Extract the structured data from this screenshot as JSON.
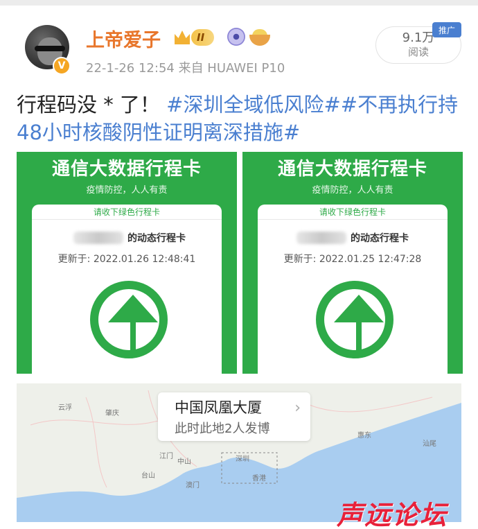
{
  "user": {
    "name": "上帝爱子",
    "level": "II",
    "verified_badge": "V",
    "meta": "22-1-26 12:54  来自 HUAWEI P10"
  },
  "read_count": {
    "value": "9.1万",
    "label": "阅读",
    "ad_tag": "推广"
  },
  "post": {
    "text_plain": "行程码没 * 了！",
    "tag1": "#深圳全域低风险#",
    "tag2": "#不再执行持48小时核酸阴性证明离深措施#"
  },
  "cards": [
    {
      "title": "通信大数据行程卡",
      "subtitle": "疫情防控，人人有责",
      "notice": "请收下绿色行程卡",
      "dynamic_label": "的动态行程卡",
      "updated": "更新于: 2022.01.26 12:48:41",
      "color": "#2eaa48"
    },
    {
      "title": "通信大数据行程卡",
      "subtitle": "疫情防控，人人有责",
      "notice": "请收下绿色行程卡",
      "dynamic_label": "的动态行程卡",
      "updated": "更新于: 2022.01.25 12:47:28",
      "color": "#2eaa48"
    }
  ],
  "location": {
    "name": "中国凤凰大厦",
    "sub": "此时此地2人发博"
  },
  "map_labels": [
    "肇庆",
    "云浮",
    "江门",
    "中山",
    "澳门",
    "深圳",
    "香港",
    "汕尾",
    "惠东",
    "台山"
  ],
  "watermark": "声远论坛",
  "icons": [
    "crown-icon",
    "eye-icon",
    "noodle-bowl-icon",
    "chevron-right-icon",
    "up-arrow-icon"
  ]
}
